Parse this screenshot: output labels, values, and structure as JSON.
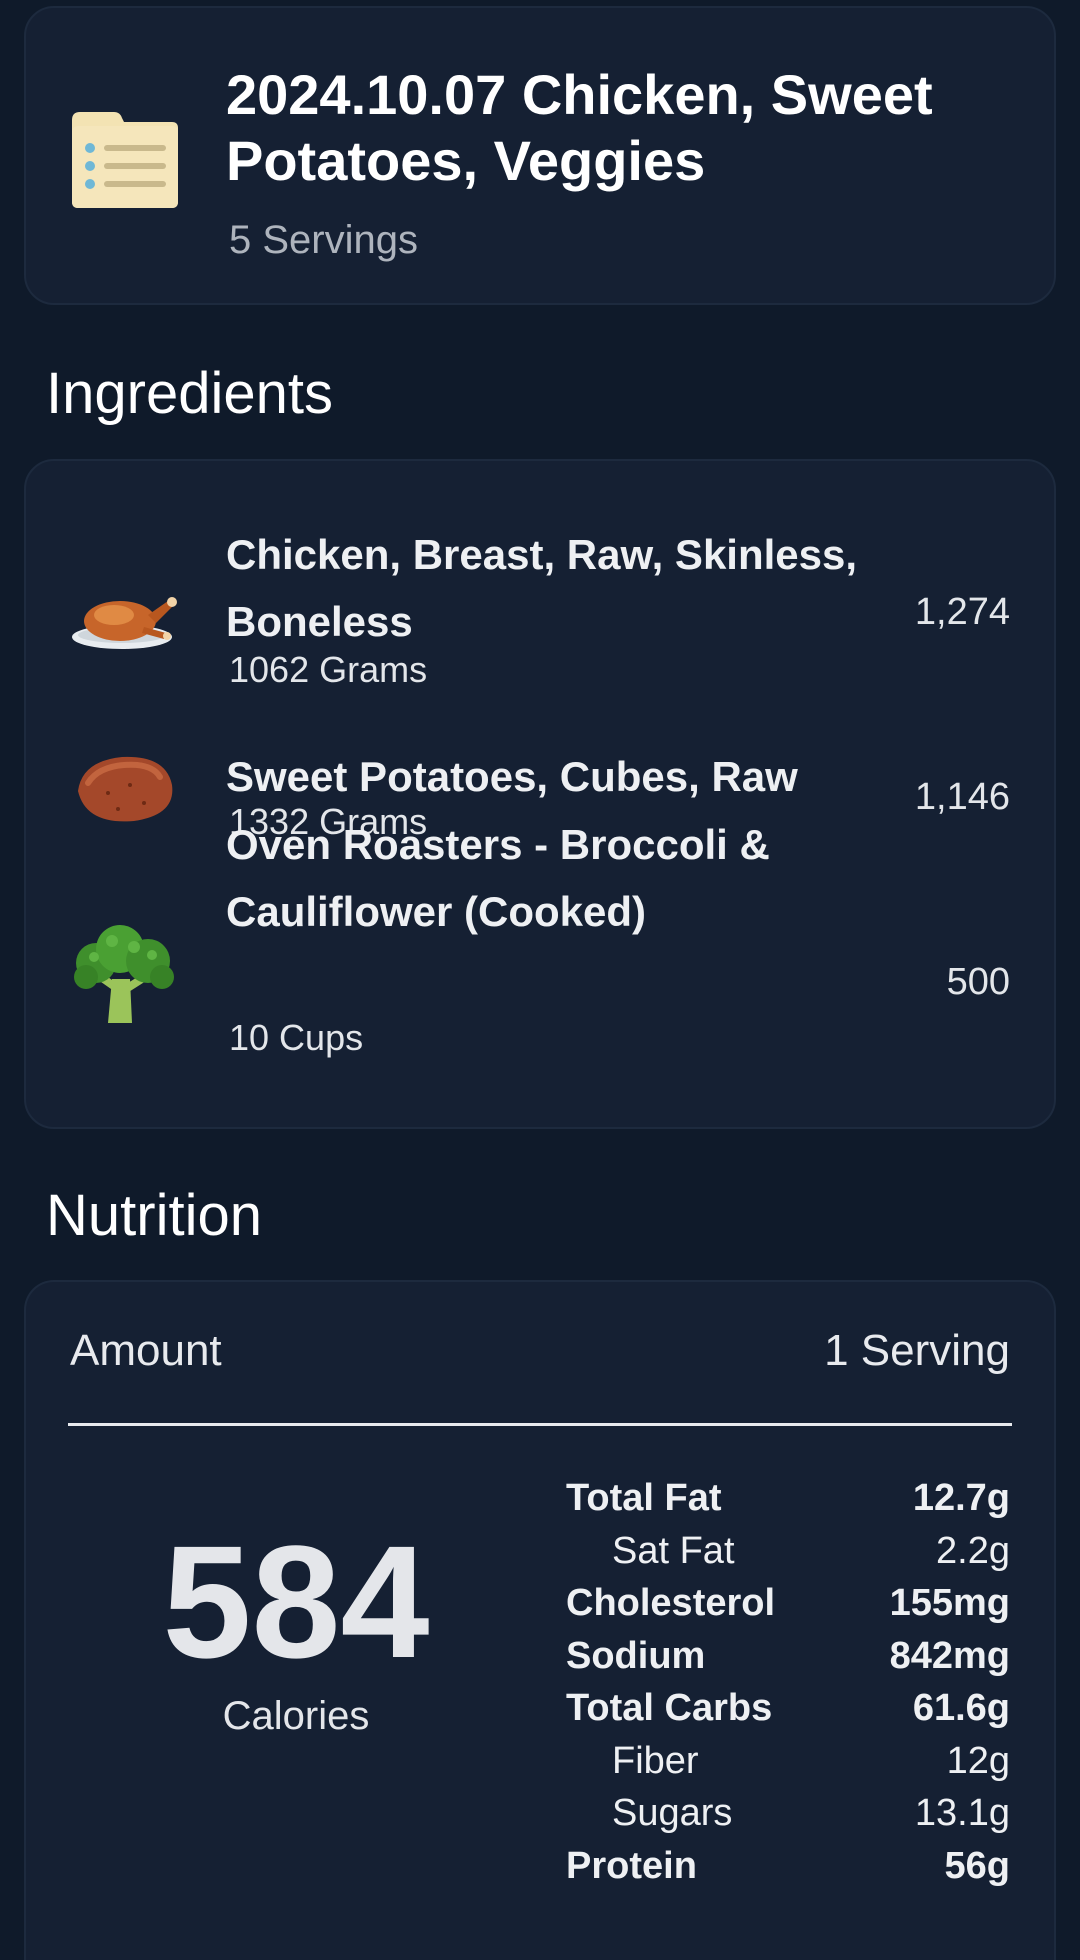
{
  "recipe": {
    "title": "2024.10.07 Chicken, Sweet Potatoes, Veggies",
    "servings": "5 Servings",
    "icon": "recipe-card-icon"
  },
  "sections": {
    "ingredients": "Ingredients",
    "nutrition": "Nutrition"
  },
  "ingredients": [
    {
      "name": "Chicken, Breast, Raw, Skinless, Boneless",
      "amount": "1062 Grams",
      "calories": "1,274",
      "icon": "roast-chicken-icon"
    },
    {
      "name": "Sweet Potatoes, Cubes, Raw",
      "amount": "1332 Grams",
      "calories": "1,146",
      "icon": "sweet-potato-icon"
    },
    {
      "name": "Oven Roasters - Broccoli & Cauliflower (Cooked)",
      "amount": "10 Cups",
      "calories": "500",
      "icon": "broccoli-icon"
    }
  ],
  "nutrition": {
    "amount_label": "Amount",
    "serving_label": "1 Serving",
    "calories_value": "584",
    "calories_label": "Calories",
    "rows": [
      {
        "name": "Total Fat",
        "value": "12.7g"
      },
      {
        "name": "Sat Fat",
        "value": "2.2g"
      },
      {
        "name": "Cholesterol",
        "value": "155mg"
      },
      {
        "name": "Sodium",
        "value": "842mg"
      },
      {
        "name": "Total Carbs",
        "value": "61.6g"
      },
      {
        "name": "Fiber",
        "value": "12g"
      },
      {
        "name": "Sugars",
        "value": "13.1g"
      },
      {
        "name": "Protein",
        "value": "56g"
      }
    ]
  }
}
